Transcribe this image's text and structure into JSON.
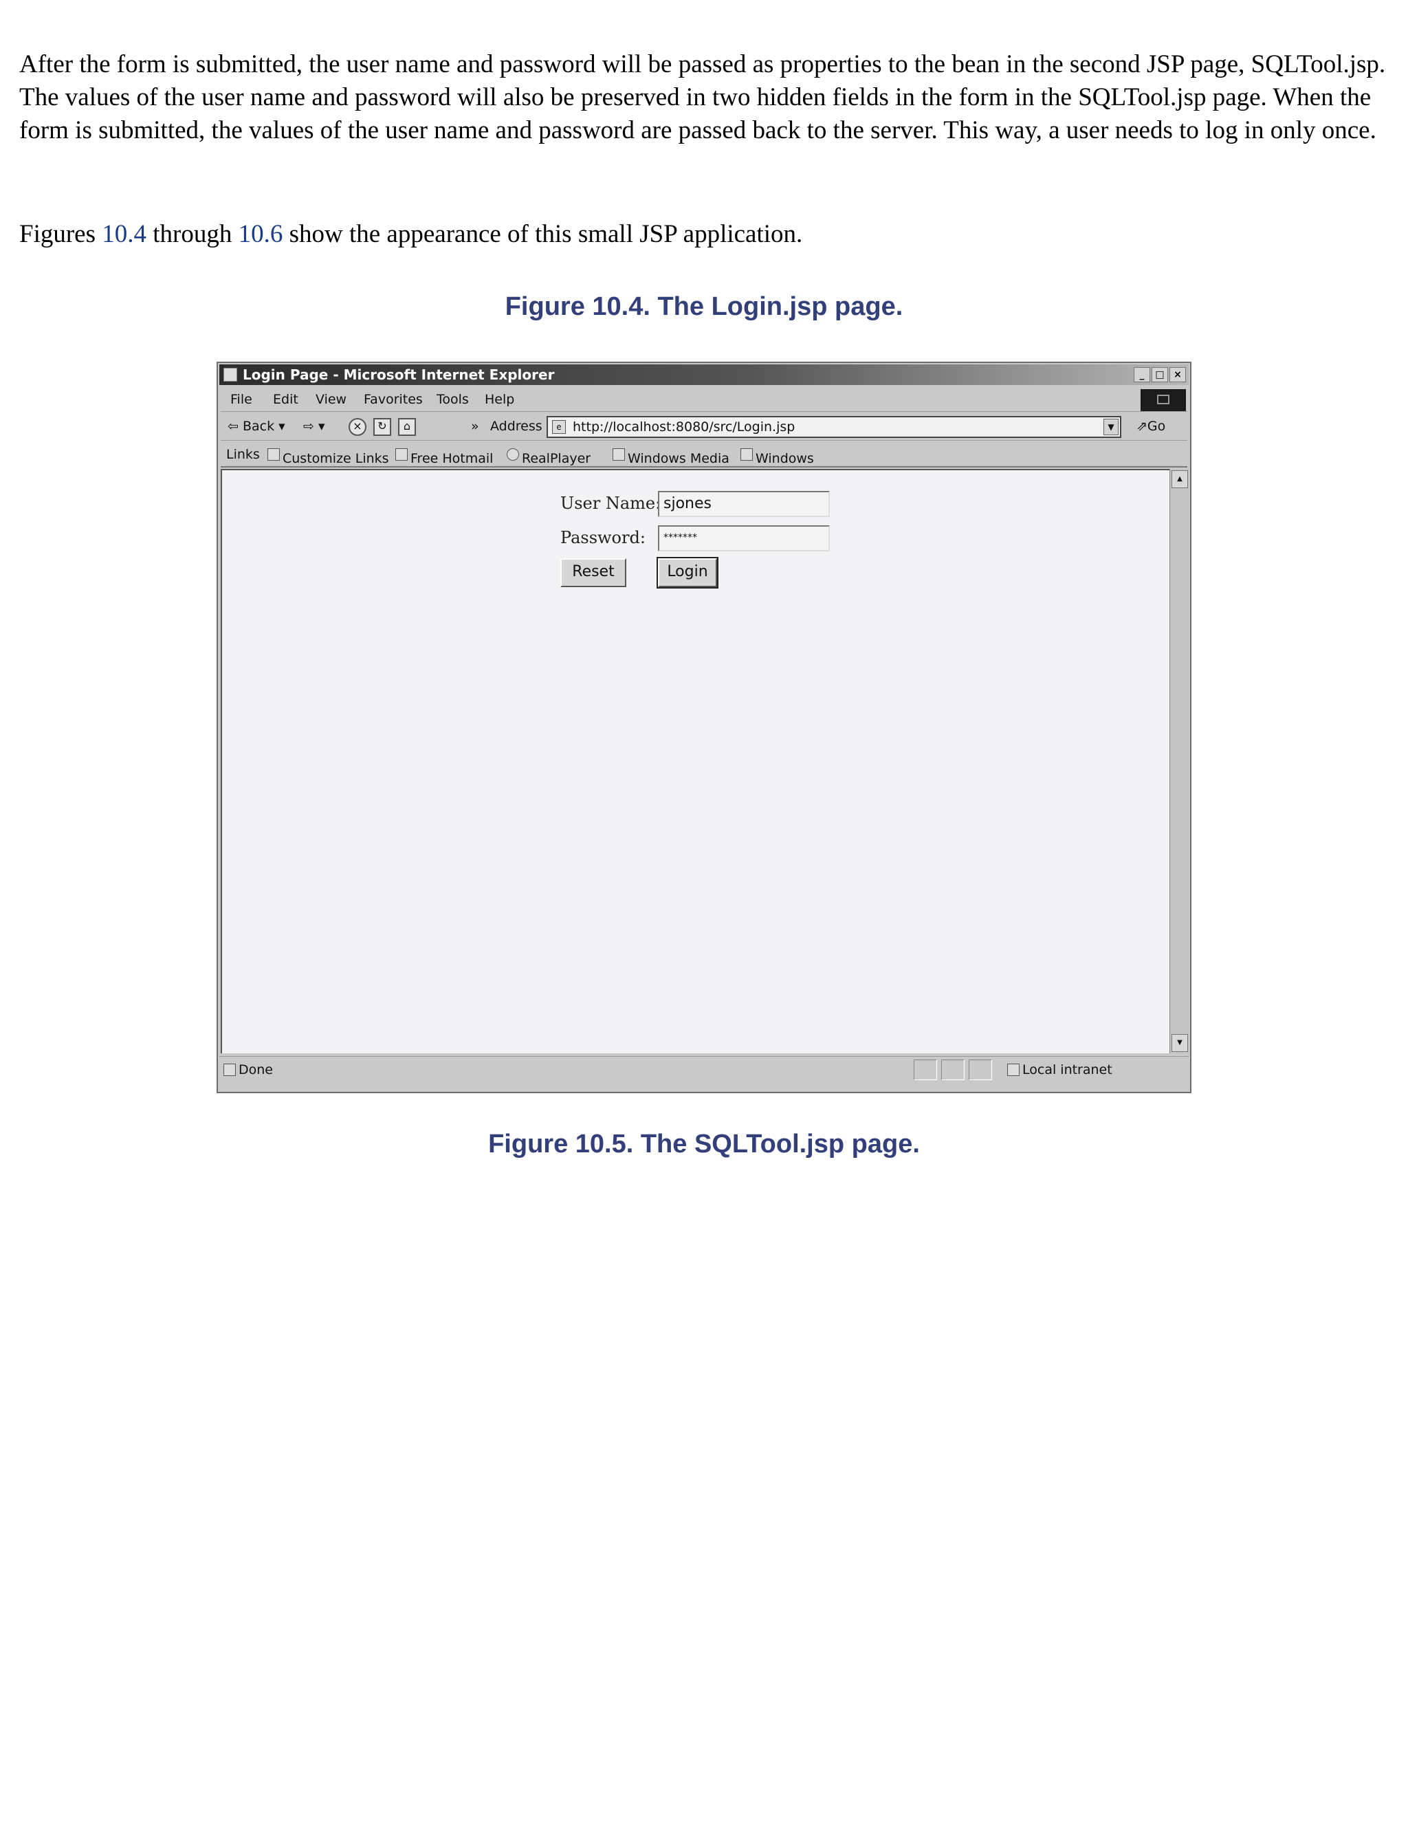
{
  "paragraphs": {
    "p1": "After the form is submitted, the user name and password will be passed as properties to the bean in the second JSP page, SQLTool.jsp. The values of the user name and password will also be preserved in two hidden fields in the form in the SQLTool.jsp page. When the form is submitted, the values of the user name and password are passed back to the server. This way, a user needs to log in only once.",
    "p2_before": "Figures ",
    "p2_link1": "10.4",
    "p2_middle": " through ",
    "p2_link2": "10.6",
    "p2_after": " show the appearance of this small JSP application."
  },
  "figures": {
    "fig1_caption": "Figure 10.4. The Login.jsp page.",
    "fig2_caption": "Figure 10.5. The SQLTool.jsp page."
  },
  "browser": {
    "title": "Login Page - Microsoft Internet Explorer",
    "window_buttons": [
      "_",
      "□",
      "×"
    ],
    "menu": [
      "File",
      "Edit",
      "View",
      "Favorites",
      "Tools",
      "Help"
    ],
    "toolbar": {
      "back": "Back",
      "more": "»",
      "address_label": "Address",
      "url": "http://localhost:8080/src/Login.jsp",
      "go": "Go"
    },
    "links": {
      "label": "Links",
      "items": [
        "Customize Links",
        "Free Hotmail",
        "RealPlayer",
        "Windows Media",
        "Windows"
      ]
    },
    "form": {
      "username_label": "User Name:",
      "username_value": "sjones",
      "password_label": "Password:",
      "password_value": "*******",
      "reset_label": "Reset",
      "login_label": "Login"
    },
    "status": {
      "text": "Done",
      "zone": "Local intranet"
    }
  }
}
